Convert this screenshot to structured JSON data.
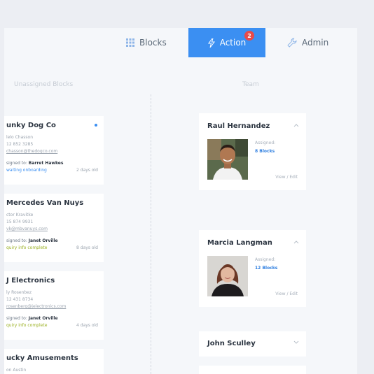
{
  "tabs": {
    "blocks": "Blocks",
    "action": "Action",
    "action_badge": "2",
    "admin": "Admin"
  },
  "columns": {
    "unassigned": "Unassigned Blocks",
    "team": "Team"
  },
  "unassigned_blocks": [
    {
      "title": "unky Dog Co",
      "l1": "lelo Chasson",
      "l2": "12 852 3285",
      "l3": "chasson@thedogco.com",
      "assigned": "signed to: ",
      "assignee": "Barret Hawkes",
      "status": "waiting onboarding",
      "age": "2 days old"
    },
    {
      "title": "Mercedes Van Nuys",
      "l1": "ctor Kravitke",
      "l2": "15 874 9931",
      "l3": "vk@mbvanuys.com",
      "assigned": "signed to: ",
      "assignee": "Janet Orville",
      "status": "quiry info complete",
      "age": "8 days old"
    },
    {
      "title": "J Electronics",
      "l1": "ly Rosenbez",
      "l2": "12 431 8734",
      "l3": "rosenberg@jelectronics.com",
      "assigned": "signed to: ",
      "assignee": "Janet Orville",
      "status": "quiry info complete",
      "age": "4 days old"
    },
    {
      "title": "ucky Amusements",
      "l1": "on Austin"
    }
  ],
  "team": [
    {
      "name": "Raul Hernandez",
      "assigned_label": "Assigned:",
      "blocks": "8 Blocks",
      "view_edit": "View / Edit"
    },
    {
      "name": "Marcia Langman",
      "assigned_label": "Assigned:",
      "blocks": "12 Blocks",
      "view_edit": "View / Edit"
    },
    {
      "name": "John Sculley"
    }
  ],
  "colors": {
    "accent": "#3b8ff2",
    "badge": "#e84a4a",
    "status_blue": "#3b8ff2",
    "status_green": "#9ab020"
  },
  "icons": {
    "blocks": "grid-icon",
    "action": "lightning-icon",
    "admin": "wrench-icon"
  }
}
